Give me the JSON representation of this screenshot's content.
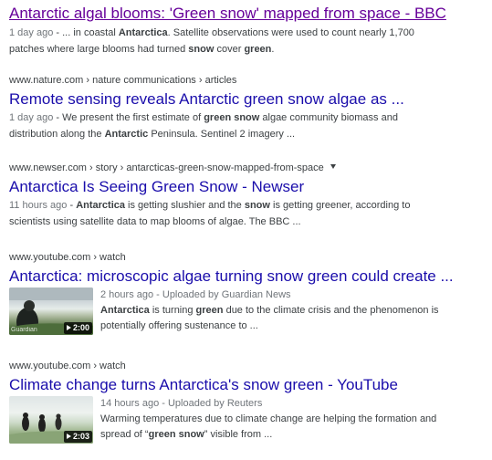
{
  "results": [
    {
      "title": "Antarctic algal blooms: 'Green snow' mapped from space - BBC",
      "date": "1 day ago",
      "snippet_lines": [
        [
          {
            "t": " - ... in coastal "
          },
          {
            "t": "Antarctica",
            "b": true
          },
          {
            "t": ". Satellite observations were used to count nearly 1,700"
          }
        ],
        [
          {
            "t": "patches where large blooms had turned "
          },
          {
            "t": "snow",
            "b": true
          },
          {
            "t": " cover "
          },
          {
            "t": "green",
            "b": true
          },
          {
            "t": "."
          }
        ]
      ]
    },
    {
      "cite": "www.nature.com › nature communications › articles",
      "title": "Remote sensing reveals Antarctic green snow algae as ...",
      "date": "1 day ago",
      "snippet_lines": [
        [
          {
            "t": " - We present the first estimate of "
          },
          {
            "t": "green snow",
            "b": true
          },
          {
            "t": " algae community biomass and"
          }
        ],
        [
          {
            "t": "distribution along the "
          },
          {
            "t": "Antarctic",
            "b": true
          },
          {
            "t": " Peninsula. Sentinel 2 imagery ..."
          }
        ]
      ]
    },
    {
      "cite": "www.newser.com › story › antarcticas-green-snow-mapped-from-space",
      "title": "Antarctica Is Seeing Green Snow - Newser",
      "date": "11 hours ago",
      "snippet_lines": [
        [
          {
            "t": " - "
          },
          {
            "t": "Antarctica",
            "b": true
          },
          {
            "t": " is getting slushier and the "
          },
          {
            "t": "snow",
            "b": true
          },
          {
            "t": " is getting greener, according to"
          }
        ],
        [
          {
            "t": "scientists using satellite data to map blooms of algae. The BBC ..."
          }
        ]
      ]
    },
    {
      "cite": "www.youtube.com › watch",
      "title": "Antarctica: microscopic algae turning snow green could create ...",
      "meta": "2 hours ago - Uploaded by Guardian News",
      "duration": "2:00",
      "watermark": "Guardian",
      "snippet_lines": [
        [
          {
            "t": "Antarctica",
            "b": true
          },
          {
            "t": " is turning "
          },
          {
            "t": "green",
            "b": true
          },
          {
            "t": " due to the climate crisis and the phenomenon is"
          }
        ],
        [
          {
            "t": "potentially offering sustenance to ..."
          }
        ]
      ]
    },
    {
      "cite": "www.youtube.com › watch",
      "title": "Climate change turns Antarctica's snow green - YouTube",
      "meta": "14 hours ago - Uploaded by Reuters",
      "duration": "2:03",
      "snippet_lines": [
        [
          {
            "t": "Warming temperatures due to climate change are helping the formation and"
          }
        ],
        [
          {
            "t": "spread of “"
          },
          {
            "t": "green snow",
            "b": true
          },
          {
            "t": "” visible from ..."
          }
        ]
      ]
    }
  ],
  "colors": {
    "link": "#1a0dab",
    "visited": "#660099",
    "text": "#3c4043",
    "muted": "#70757a"
  }
}
